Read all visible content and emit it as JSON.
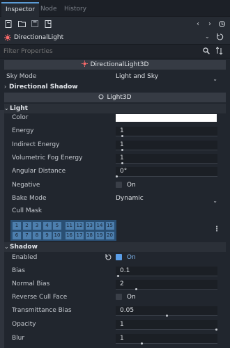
{
  "tabs": [
    "Inspector",
    "Node",
    "History"
  ],
  "object_selector": {
    "label": "DirectionalLight"
  },
  "filter": {
    "placeholder": "Filter Properties"
  },
  "class_header": "DirectionalLight3D",
  "sky_mode": {
    "label": "Sky Mode",
    "value": "Light and Sky"
  },
  "directional_shadow_label": "Directional Shadow",
  "light3d_header": "Light3D",
  "light_section": {
    "title": "Light",
    "rows": {
      "color": "Color",
      "energy": {
        "label": "Energy",
        "value": "1",
        "fraction": 0.06
      },
      "indirect": {
        "label": "Indirect Energy",
        "value": "1",
        "fraction": 0.06
      },
      "fog": {
        "label": "Volumetric Fog Energy",
        "value": "1",
        "fraction": 0.06
      },
      "angular": {
        "label": "Angular Distance",
        "value": "0°",
        "fraction": 0.0
      },
      "negative": {
        "label": "Negative",
        "value": "On"
      },
      "bake": {
        "label": "Bake Mode",
        "value": "Dynamic"
      },
      "cull": {
        "label": "Cull Mask"
      }
    }
  },
  "cull_mask_numbers": [
    [
      "1",
      "2",
      "3",
      "4",
      "5",
      "11",
      "12",
      "13",
      "14",
      "15"
    ],
    [
      "6",
      "7",
      "8",
      "9",
      "10",
      "16",
      "17",
      "18",
      "19",
      "20"
    ]
  ],
  "shadow_section": {
    "title": "Shadow",
    "rows": {
      "enabled": {
        "label": "Enabled",
        "value": "On"
      },
      "bias": {
        "label": "Bias",
        "value": "0.1",
        "fraction": 0.02
      },
      "normal_bias": {
        "label": "Normal Bias",
        "value": "2",
        "fraction": 0.2
      },
      "reverse": {
        "label": "Reverse Cull Face",
        "value": "On"
      },
      "transmittance": {
        "label": "Transmittance Bias",
        "value": "0.05",
        "fraction": 0.5
      },
      "opacity": {
        "label": "Opacity",
        "value": "1",
        "fraction": 1.0
      },
      "blur": {
        "label": "Blur",
        "value": "1",
        "fraction": 0.25
      }
    }
  },
  "colors": {
    "accent": "#5b9bd5",
    "bg": "#21262e",
    "cull_cell": "#4d7fae"
  },
  "icons": [
    "new-scene-icon",
    "open-icon",
    "save-icon",
    "resource-icon",
    "back-icon",
    "forward-icon",
    "history-icon",
    "light-node-icon",
    "dropdown-icon",
    "search-icon",
    "sort-icon",
    "revert-icon",
    "kebab-icon"
  ]
}
